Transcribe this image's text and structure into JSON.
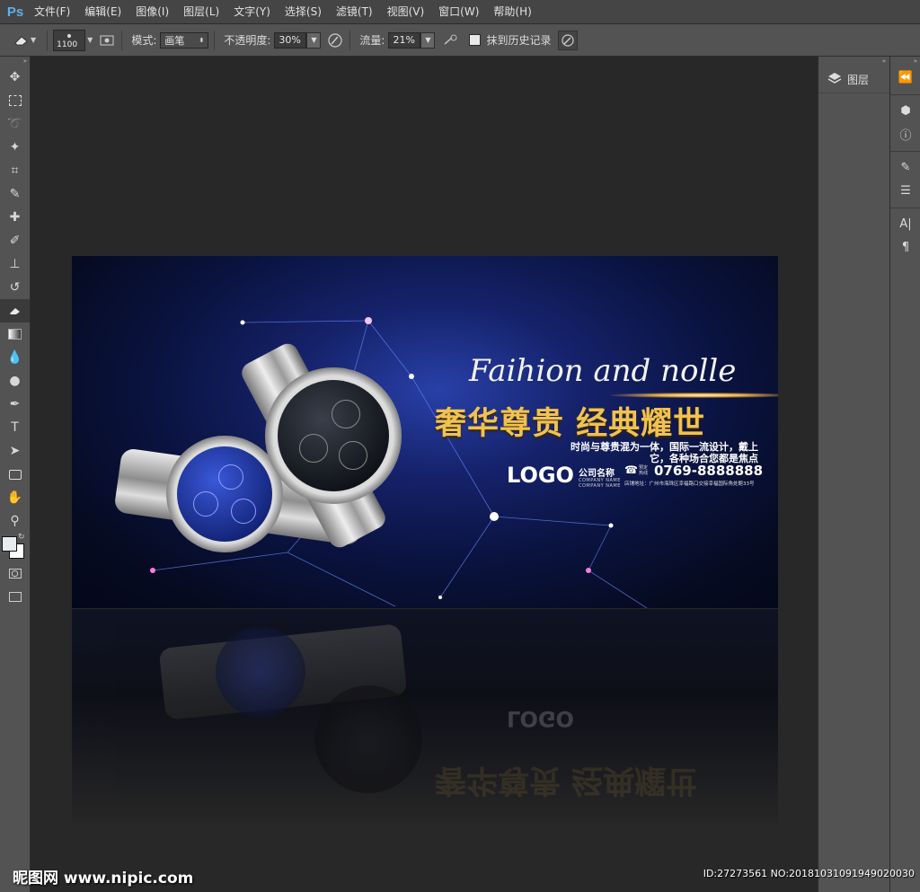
{
  "app": {
    "logo": "Ps"
  },
  "menu": [
    "文件(F)",
    "编辑(E)",
    "图像(I)",
    "图层(L)",
    "文字(Y)",
    "选择(S)",
    "滤镜(T)",
    "视图(V)",
    "窗口(W)",
    "帮助(H)"
  ],
  "options": {
    "brush_size": "1100",
    "mode_label": "模式:",
    "mode_value": "画笔",
    "opacity_label": "不透明度:",
    "opacity_value": "30%",
    "flow_label": "流量:",
    "flow_value": "21%",
    "erase_history_label": "抹到历史记录"
  },
  "tools": [
    "move-tool-icon",
    "marquee-tool-icon",
    "lasso-tool-icon",
    "magic-wand-tool-icon",
    "crop-tool-icon",
    "eyedropper-tool-icon",
    "healing-brush-tool-icon",
    "brush-tool-icon",
    "clone-stamp-tool-icon",
    "history-brush-tool-icon",
    "eraser-tool-icon",
    "gradient-tool-icon",
    "blur-tool-icon",
    "dodge-tool-icon",
    "pen-tool-icon",
    "type-tool-icon",
    "path-selection-tool-icon",
    "rectangle-tool-icon",
    "hand-tool-icon",
    "zoom-tool-icon"
  ],
  "colors": {
    "foreground": "#e6ebf0",
    "background": "#ffffff",
    "accent_gold": "#f0c252",
    "ps_blue": "#5db0f0"
  },
  "panels": {
    "layers_label": "图层"
  },
  "banner": {
    "script_title": "Faihion and nolle",
    "cn_title": "奢华尊贵 经典耀世",
    "desc_line1": "时尚与尊贵混为一体，国际一流设计，戴上",
    "desc_line2": "它，各种场合您都是焦点",
    "logo": "LOGO",
    "company_cn": "公司名称",
    "company_en": "COMPANY NAME",
    "company_en2": "COMPANY NAME",
    "phone_label": "预定热线",
    "phone": "0769-8888888",
    "address": "店铺地址：广州市海珠区幸福路口交接幸福国际角处鲍33号"
  },
  "watermark": {
    "site": "昵图网 www.nipic.com",
    "id": "ID:27273561 NO:20181031091949020030"
  }
}
